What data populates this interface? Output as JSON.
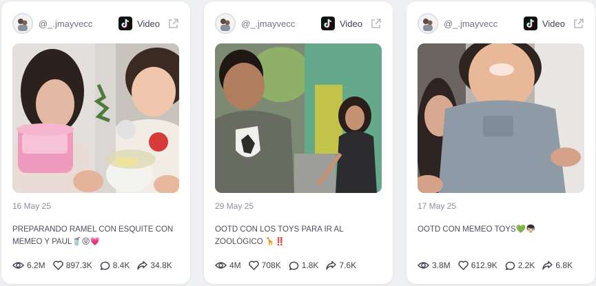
{
  "cards": [
    {
      "handle": "@_.jmayvecc",
      "type_label": "Video",
      "date": "16 May 25",
      "caption": "PREPARANDO RAMEL CON ESQUITE CON MEMEO Y PAUL🥤😝💗",
      "views": "6.2M",
      "likes": "897.3K",
      "comments": "8.4K",
      "shares": "34.8K"
    },
    {
      "handle": "@_.jmayvecc",
      "type_label": "Video",
      "date": "29 May 25",
      "caption": "OOTD CON LOS TOYS PARA IR AL ZOOLÓGICO 🦒‼️",
      "views": "4M",
      "likes": "708K",
      "comments": "1.8K",
      "shares": "7.6K"
    },
    {
      "handle": "@_.jmayvecc",
      "type_label": "Video",
      "date": "17 May 25",
      "caption": "OOTD CON MEMEO TOYS💚👦🏻",
      "views": "3.8M",
      "likes": "612.9K",
      "comments": "2.2K",
      "shares": "6.8K"
    }
  ],
  "icons": {
    "avatar": "avatar-icon",
    "platform": "tiktok-icon",
    "open": "external-link-icon",
    "views": "eye-icon",
    "likes": "heart-icon",
    "comments": "comment-icon",
    "shares": "share-icon"
  },
  "colors": {
    "background": "#eef0f3",
    "card": "#ffffff",
    "muted_text": "#8b909a",
    "tiktok": "#111111"
  }
}
